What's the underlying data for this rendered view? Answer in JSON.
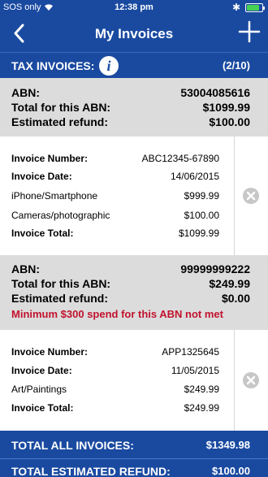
{
  "status_bar": {
    "carrier": "SOS only",
    "time": "12:38 pm",
    "battery_level": 0.85,
    "colors": {
      "battery": "#46d155"
    }
  },
  "nav": {
    "title": "My Invoices",
    "back_icon": "chevron-left-icon",
    "add_icon": "plus-icon"
  },
  "tax_invoices": {
    "label": "TAX INVOICES:",
    "info_icon_glyph": "i",
    "count": "(2/10)"
  },
  "abn_groups": [
    {
      "abn_label": "ABN:",
      "abn_value": "53004085616",
      "total_label": "Total for this ABN:",
      "total_value": "$1099.99",
      "refund_label": "Estimated refund:",
      "refund_value": "$100.00",
      "warning": "",
      "invoice": {
        "number_label": "Invoice Number:",
        "number_value": "ABC12345-67890",
        "date_label": "Invoice Date:",
        "date_value": "14/06/2015",
        "items": [
          {
            "name": "iPhone/Smartphone",
            "amount": "$999.99"
          },
          {
            "name": "Cameras/photographic",
            "amount": "$100.00"
          }
        ],
        "total_label": "Invoice Total:",
        "total_value": "$1099.99"
      }
    },
    {
      "abn_label": "ABN:",
      "abn_value": "99999999222",
      "total_label": "Total for this ABN:",
      "total_value": "$249.99",
      "refund_label": "Estimated refund:",
      "refund_value": "$0.00",
      "warning": "Minimum $300 spend for this ABN not met",
      "invoice": {
        "number_label": "Invoice Number:",
        "number_value": "APP1325645",
        "date_label": "Invoice Date:",
        "date_value": "11/05/2015",
        "items": [
          {
            "name": "Art/Paintings",
            "amount": "$249.99"
          }
        ],
        "total_label": "Invoice Total:",
        "total_value": "$249.99"
      }
    }
  ],
  "totals": {
    "all_invoices_label": "TOTAL ALL INVOICES:",
    "all_invoices_value": "$1349.98",
    "estimated_refund_label": "TOTAL ESTIMATED REFUND:",
    "estimated_refund_value": "$100.00"
  },
  "colors": {
    "brand_blue": "#1a4aa0",
    "summary_grey": "#dcdcdc",
    "warning_red": "#c1122d",
    "delete_icon_grey": "#c7c7c7"
  }
}
